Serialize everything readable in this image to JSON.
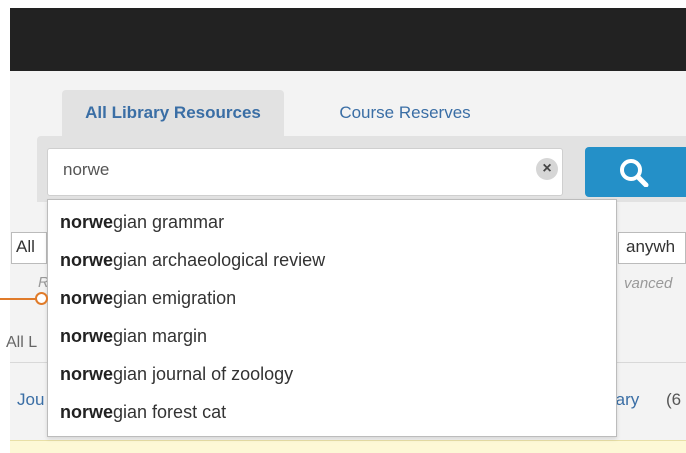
{
  "tabs": [
    {
      "label": "All Library Resources"
    },
    {
      "label": "Course Reserves"
    }
  ],
  "search": {
    "value": "norwe",
    "clear_symbol": "×"
  },
  "behind": {
    "select_left": "All",
    "select_right": "anywh",
    "hint_left": "R",
    "hint_right": "vanced",
    "all_label": "All L",
    "journals_label": "Jou",
    "library_label": "rary",
    "count_label": "(6"
  },
  "suggestions": [
    {
      "bold": "norwe",
      "rest": "gian grammar"
    },
    {
      "bold": "norwe",
      "rest": "gian archaeological review"
    },
    {
      "bold": "norwe",
      "rest": "gian emigration"
    },
    {
      "bold": "norwe",
      "rest": "gian margin"
    },
    {
      "bold": "norwe",
      "rest": "gian journal of zoology"
    },
    {
      "bold": "norwe",
      "rest": "gian forest cat"
    }
  ],
  "colors": {
    "accent": "#2490c8",
    "link": "#3a6ea5",
    "pointer": "#e07b2a"
  }
}
